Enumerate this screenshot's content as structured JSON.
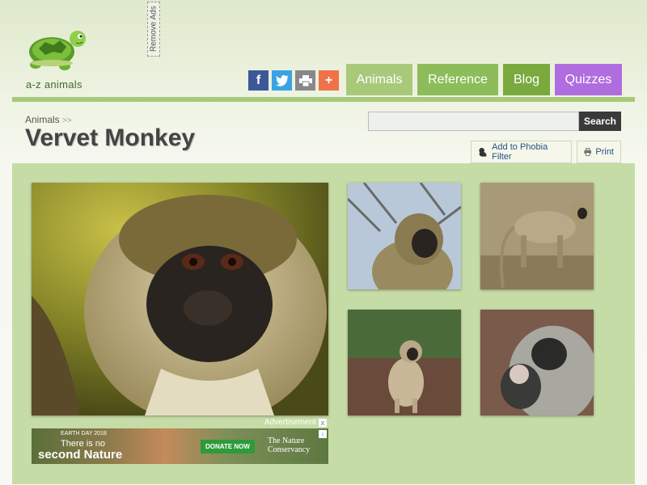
{
  "site": {
    "logo_text": "a-z animals",
    "remove_ads_label": "Remove Ads"
  },
  "share": {
    "facebook_icon": "f",
    "twitter_icon": "twitter-bird",
    "print_icon": "printer",
    "more_icon": "+"
  },
  "nav": {
    "tabs": [
      {
        "label": "Animals",
        "color": "#a9c97a"
      },
      {
        "label": "Reference",
        "color": "#8dbd5a"
      },
      {
        "label": "Blog",
        "color": "#7aa93e"
      },
      {
        "label": "Quizzes",
        "color": "#b06de0"
      }
    ]
  },
  "breadcrumb": {
    "root": "Animals",
    "separator": ">>"
  },
  "page": {
    "title": "Vervet Monkey"
  },
  "search": {
    "value": "",
    "placeholder": "",
    "button_label": "Search"
  },
  "actions": {
    "phobia_label": "Add to Phobia Filter",
    "print_label": "Print"
  },
  "ad": {
    "label": "Advertisement",
    "close": "x",
    "small_line": "EARTH DAY 2018",
    "line1": "There is no",
    "line2": "second Nature",
    "donate": "DONATE NOW",
    "brand_line1": "The Nature",
    "brand_line2": "Conservancy"
  },
  "colors": {
    "accent_green": "#a8c97a",
    "gallery_bg": "#c6dca6",
    "search_button": "#3a3a3a",
    "quizzes_purple": "#b06de0"
  }
}
